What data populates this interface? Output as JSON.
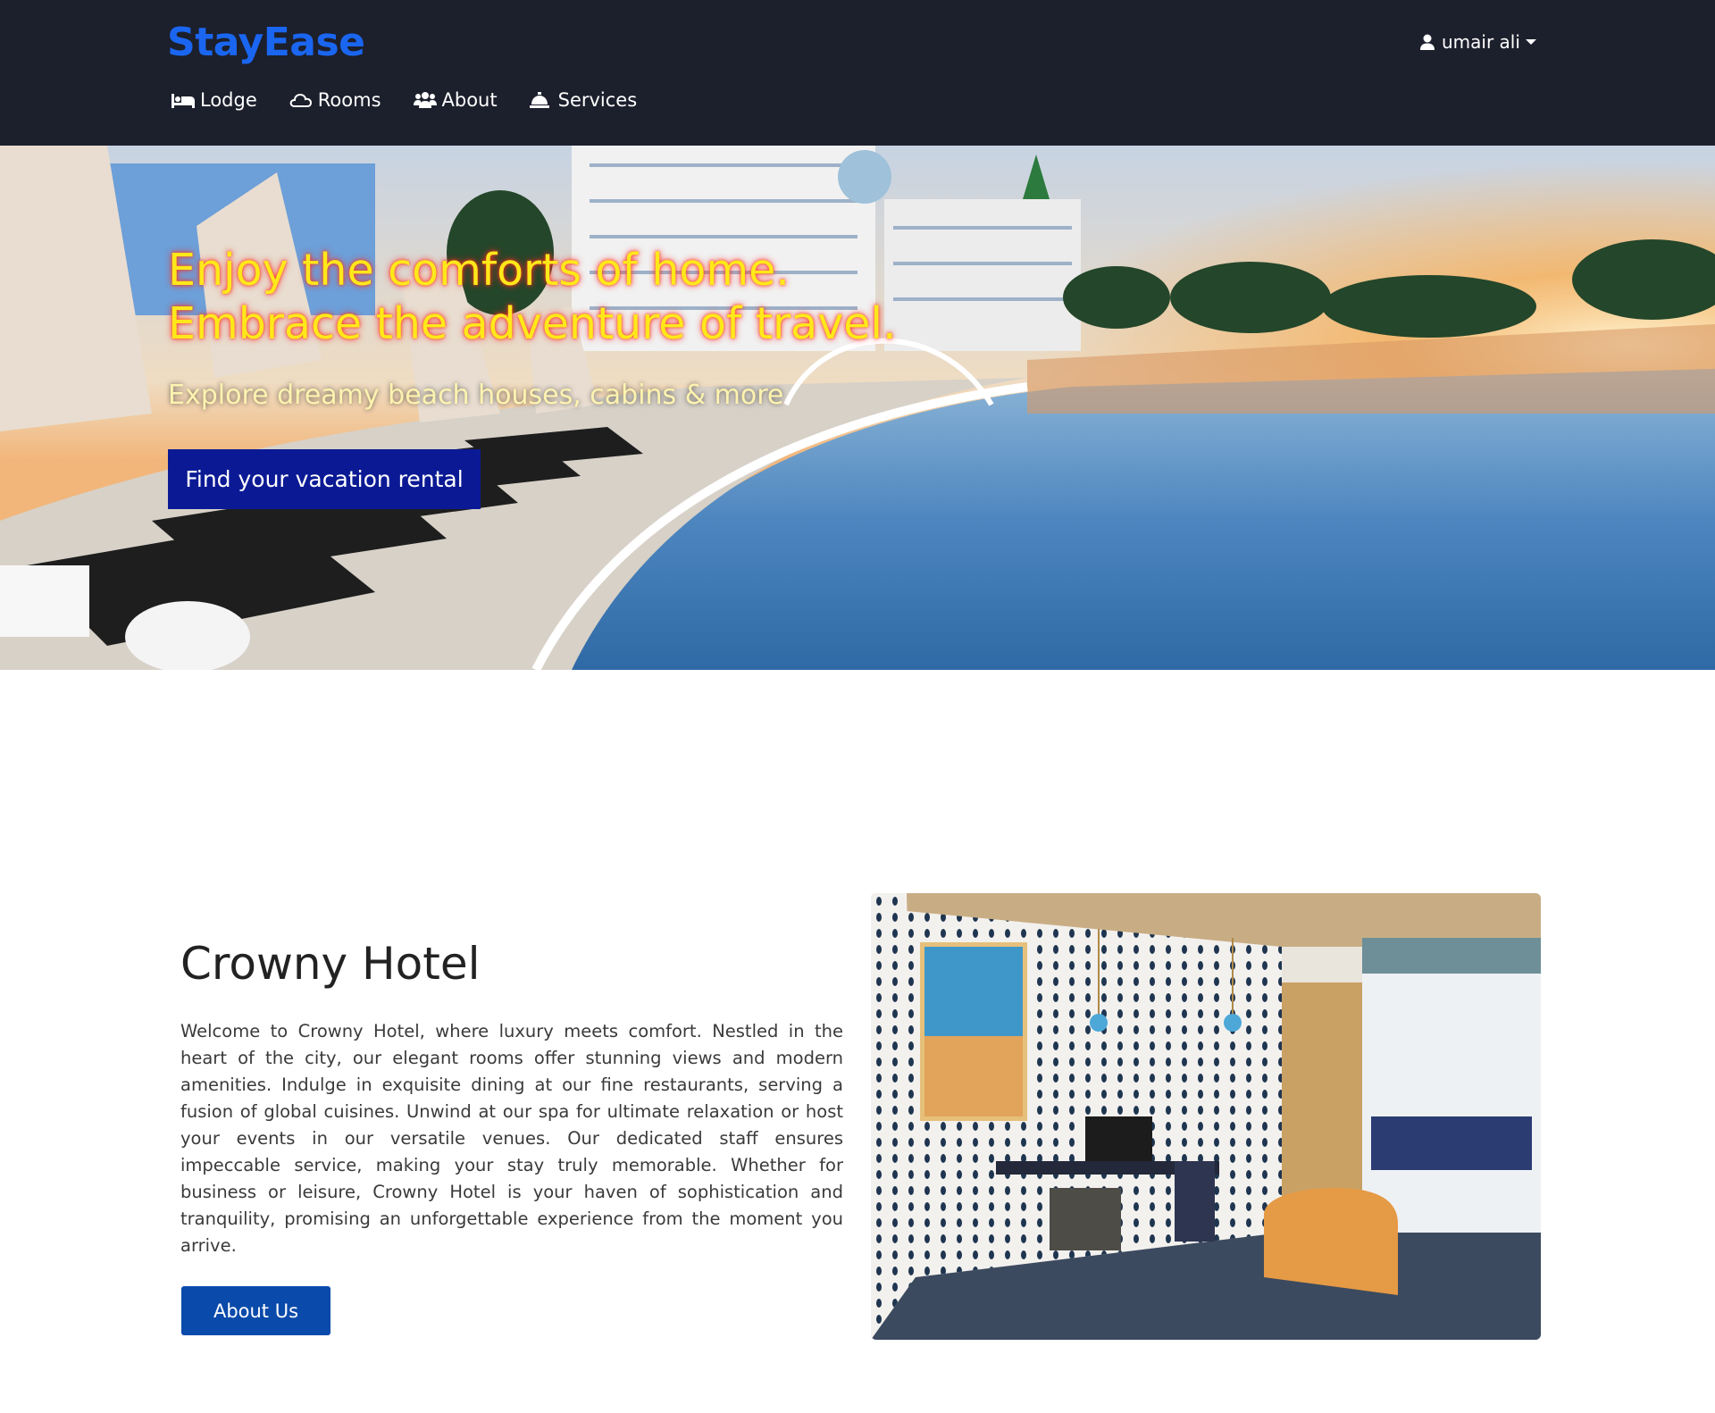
{
  "navbar": {
    "brand": "StayEase",
    "user": {
      "name": "umair ali",
      "icon": "user-icon"
    },
    "links": [
      {
        "label": "Lodge",
        "icon": "bed-icon"
      },
      {
        "label": "Rooms",
        "icon": "cloud-icon"
      },
      {
        "label": "About",
        "icon": "users-icon"
      },
      {
        "label": "Services",
        "icon": "bell-icon"
      }
    ]
  },
  "hero": {
    "title_line1": "Enjoy the comforts of home.",
    "title_line2": "Embrace the adventure of travel.",
    "subtitle": "Explore dreamy beach houses, cabins & more",
    "cta_label": "Find your vacation rental"
  },
  "about": {
    "title": "Crowny Hotel",
    "text": "Welcome to Crowny Hotel, where luxury meets comfort. Nestled in the heart of the city, our elegant rooms offer stunning views and modern amenities. Indulge in exquisite dining at our fine restaurants, serving a fusion of global cuisines. Unwind at our spa for ultimate relaxation or host your events in our versatile venues. Our dedicated staff ensures impeccable service, making your stay truly memorable. Whether for business or leisure, Crowny Hotel is your haven of sophistication and tranquility, promising an unforgettable experience from the moment you arrive.",
    "button_label": "About Us"
  },
  "colors": {
    "navbar_bg": "#1c1f2c",
    "brand": "#1a66f0",
    "hero_title": "#ffe81a",
    "hero_cta": "#0b1a94",
    "about_btn": "#0a4aaa"
  }
}
